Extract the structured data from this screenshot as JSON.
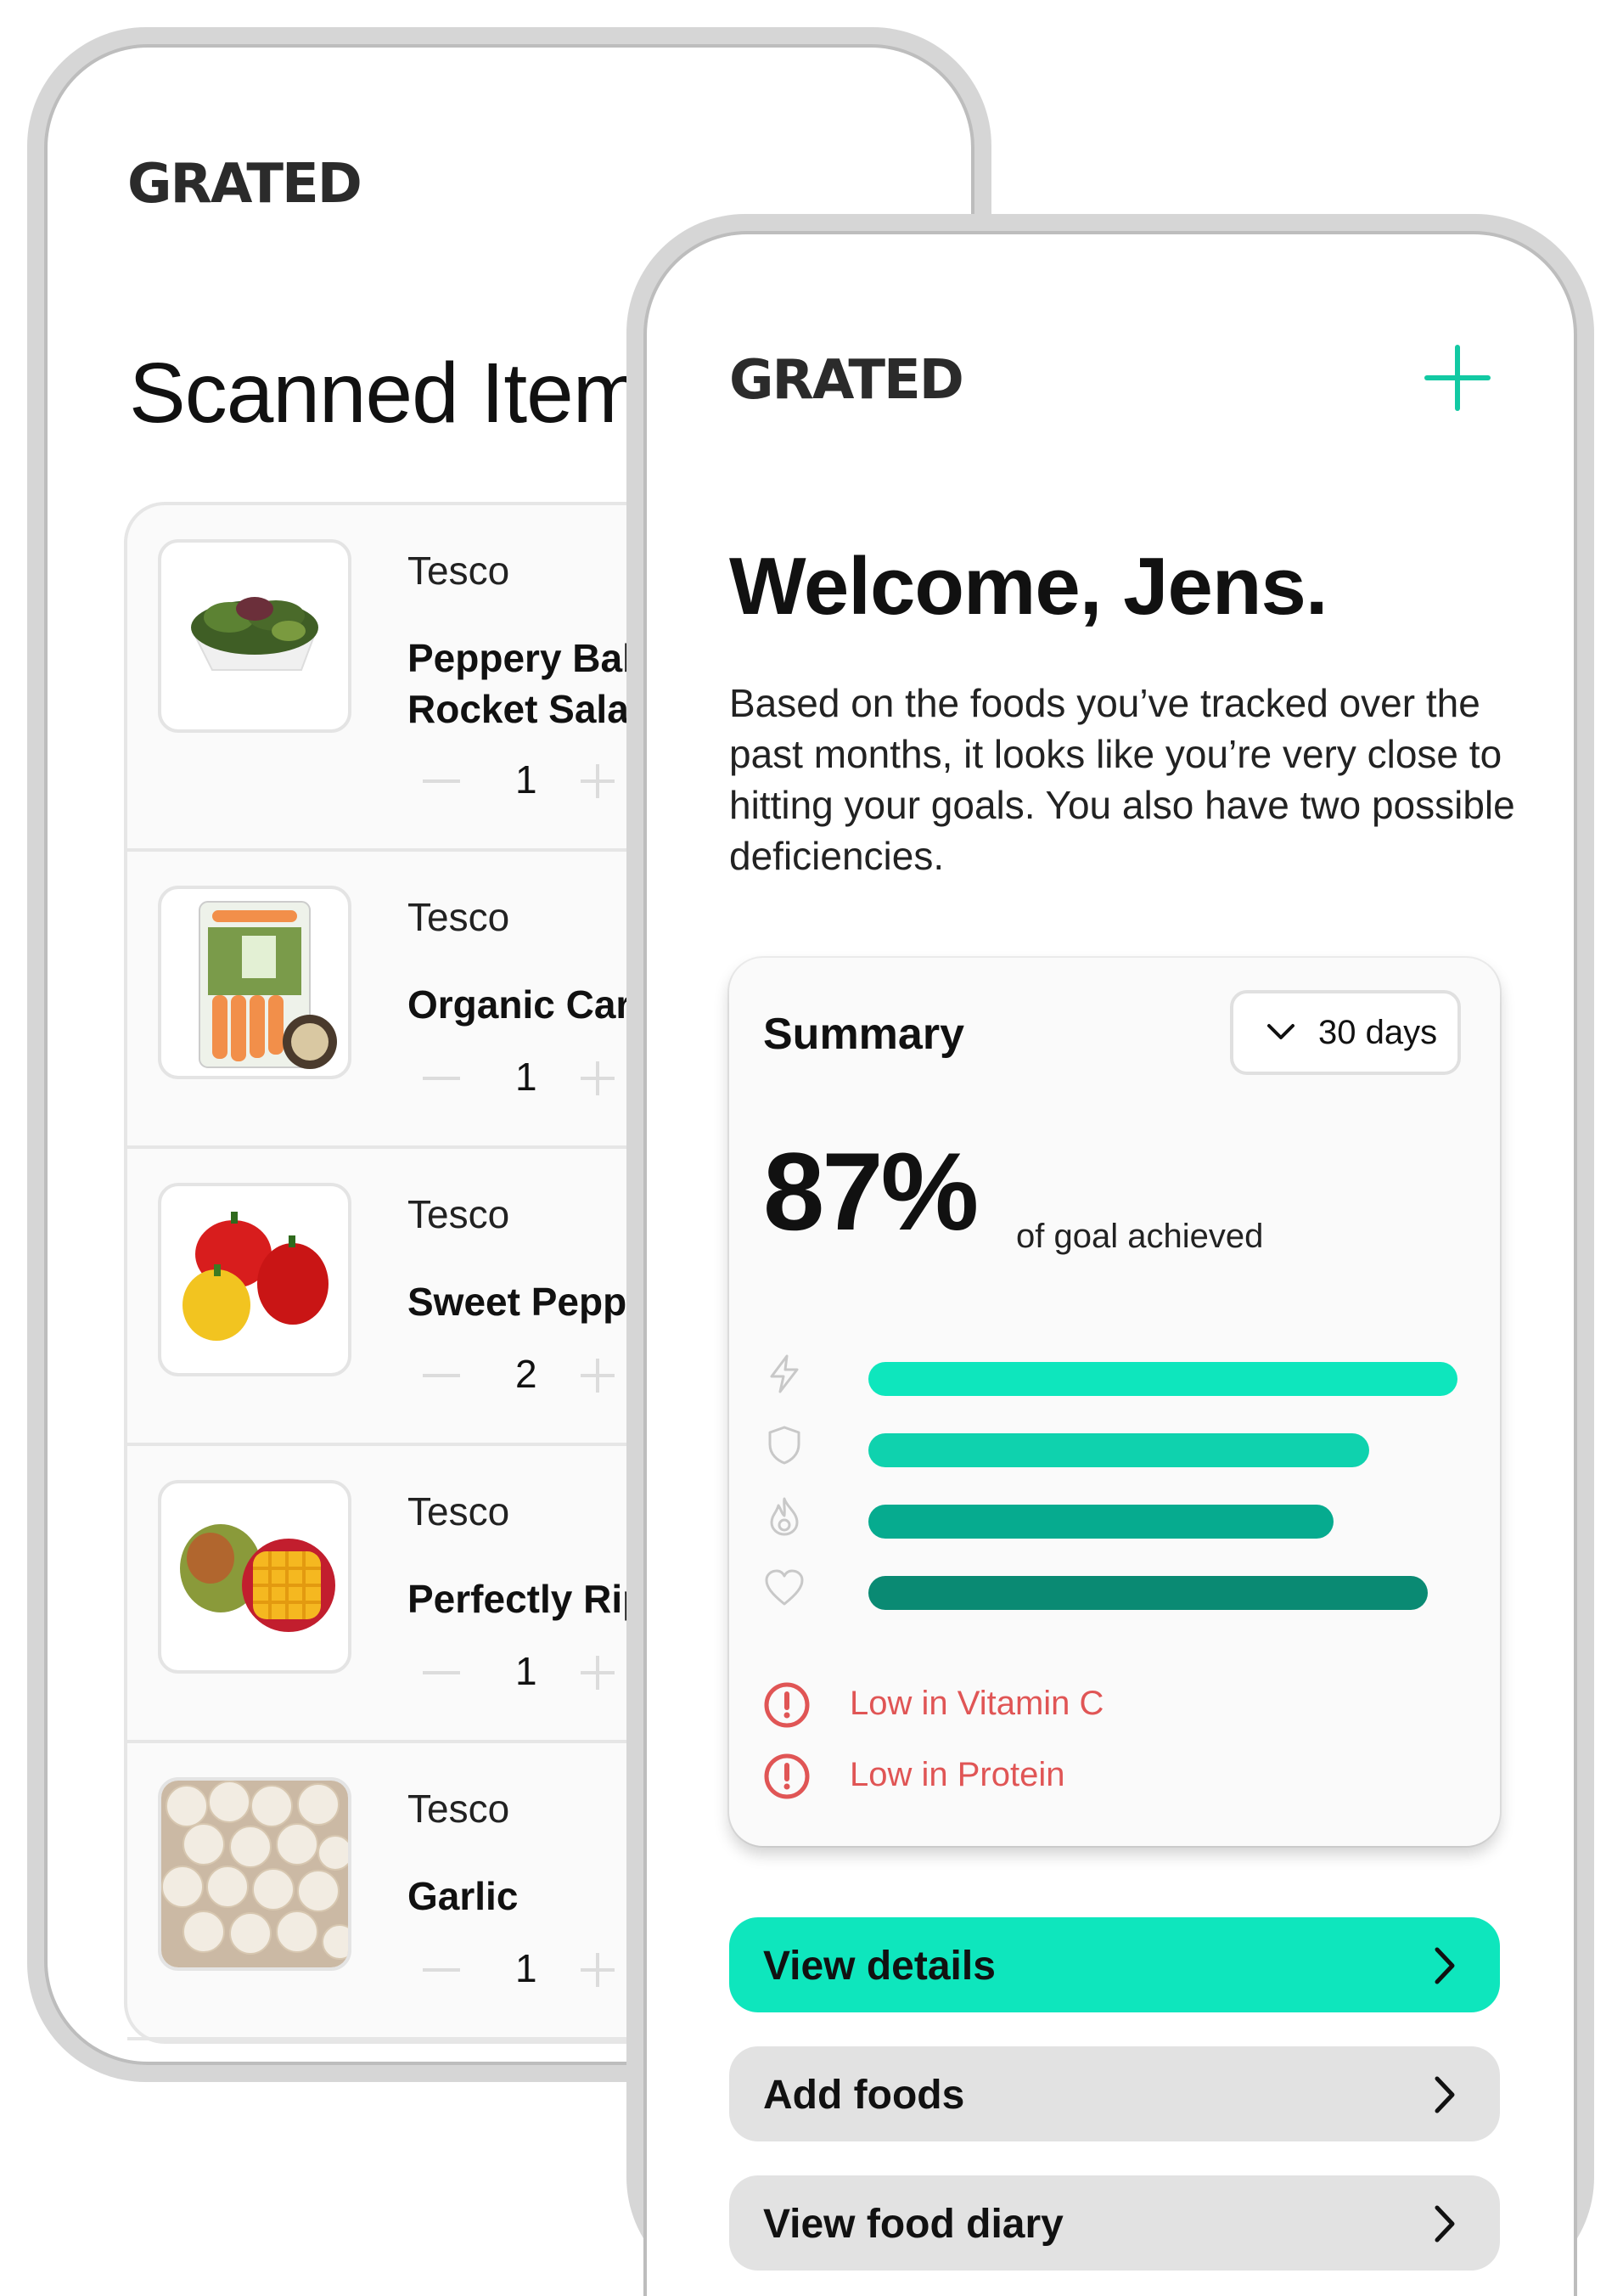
{
  "scanned_screen": {
    "logo": "GRATED",
    "title": "Scanned Items",
    "items": [
      {
        "store": "Tesco",
        "name_line1": "Peppery Baby",
        "name_line2": "Rocket Salad",
        "qty": "1",
        "image": "salad-leaves"
      },
      {
        "store": "Tesco",
        "name_line1": "Organic Carrots",
        "name_line2": "",
        "qty": "1",
        "image": "carrots-pack"
      },
      {
        "store": "Tesco",
        "name_line1": "Sweet Peppers",
        "name_line2": "",
        "qty": "2",
        "image": "bell-peppers"
      },
      {
        "store": "Tesco",
        "name_line1": "Perfectly Ripe",
        "name_line2": "",
        "qty": "1",
        "image": "mango"
      },
      {
        "store": "Tesco",
        "name_line1": "Garlic",
        "name_line2": "",
        "qty": "1",
        "image": "garlic-bulbs"
      }
    ]
  },
  "home_screen": {
    "logo": "GRATED",
    "add_icon": "plus-icon",
    "welcome": "Welcome, Jens.",
    "intro": "Based on the foods you’ve tracked over the past months, it looks like you’re very close to hitting your goals. You also have two possible deficiencies.",
    "summary": {
      "title": "Summary",
      "range_label": "30 days",
      "percent": "87%",
      "percent_caption": "of goal achieved",
      "metrics": [
        {
          "icon": "lightning-icon",
          "level": 1.0,
          "color": "#0ee6bd"
        },
        {
          "icon": "shield-icon",
          "level": 0.85,
          "color": "#0fd2ae"
        },
        {
          "icon": "flame-icon",
          "level": 0.79,
          "color": "#06ab8f"
        },
        {
          "icon": "heart-icon",
          "level": 0.95,
          "color": "#0a8a73"
        }
      ],
      "warnings": [
        {
          "icon": "alert-circle-icon",
          "text": "Low in Vitamin C"
        },
        {
          "icon": "alert-circle-icon",
          "text": "Low in Protein"
        }
      ]
    },
    "actions": [
      {
        "label": "View details",
        "color": "#0ee6bd"
      },
      {
        "label": "Add foods",
        "color": "#e2e2e2"
      },
      {
        "label": "View food diary",
        "color": "#e2e2e2"
      }
    ]
  }
}
